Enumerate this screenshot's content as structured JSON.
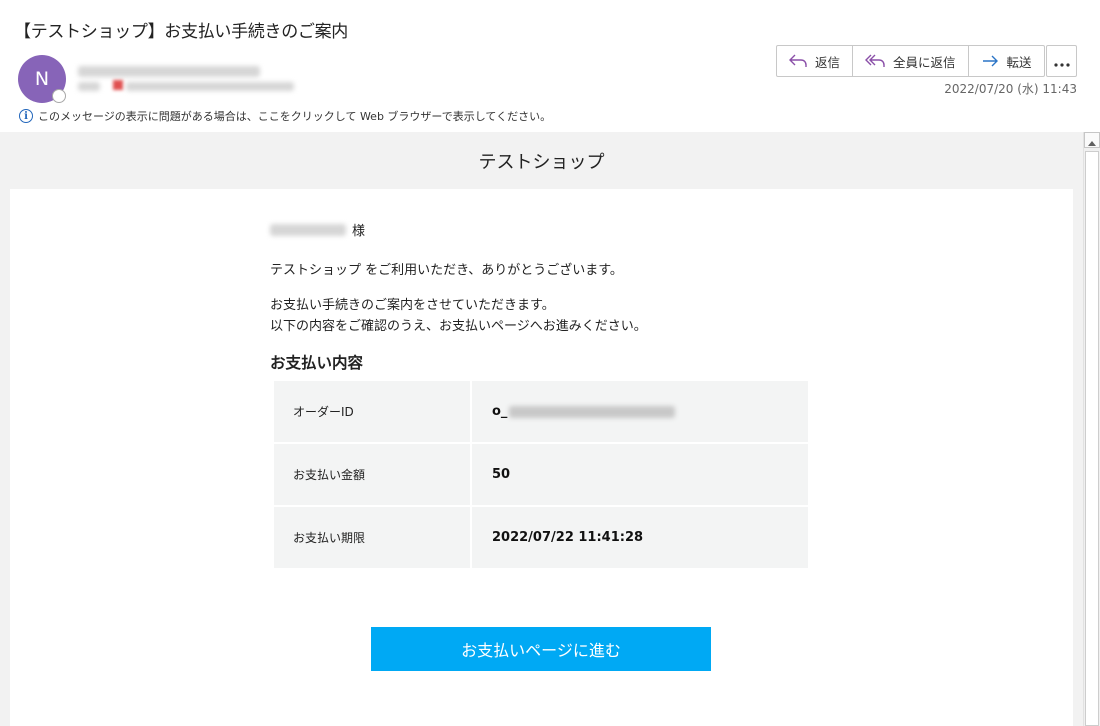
{
  "email": {
    "subject": "【テストショップ】お支払い手続きのご案内",
    "avatar_initial": "N",
    "date": "2022/07/20 (水) 11:43",
    "info_bar": "このメッセージの表示に問題がある場合は、ここをクリックして Web ブラウザーで表示してください。",
    "actions": [
      {
        "label": "返信",
        "icon": "reply-icon"
      },
      {
        "label": "全員に返信",
        "icon": "reply-all-icon"
      },
      {
        "label": "転送",
        "icon": "forward-icon"
      }
    ],
    "more_icon": "more-options-icon"
  },
  "message": {
    "shop_name": "テストショップ",
    "salutation_suffix": "様",
    "para1": "テストショップ をご利用いただき、ありがとうございます。",
    "para2_line1": "お支払い手続きのご案内をさせていただきます。",
    "para2_line2": "以下の内容をご確認のうえ、お支払いページへお進みください。",
    "section_title": "お支払い内容",
    "rows": [
      {
        "label": "オーダーID",
        "value": "o_"
      },
      {
        "label": "お支払い金額",
        "value": "50"
      },
      {
        "label": "お支払い期限",
        "value": "2022/07/22 11:41:28"
      }
    ],
    "pay_button": "お支払いページに進む"
  },
  "colors": {
    "accent_button": "#00a9f4",
    "avatar": "#8764b8",
    "info_icon": "#2266bb"
  }
}
